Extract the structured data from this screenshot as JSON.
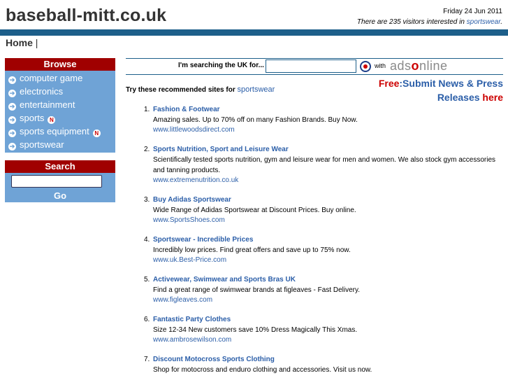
{
  "header": {
    "site_title": "baseball-mitt.co.uk",
    "date": "Friday 24 Jun 2011",
    "visitors_prefix": "There are 235 visitors interested in ",
    "visitors_link": "sportswear",
    "visitors_suffix": "."
  },
  "nav": {
    "home": "Home",
    "sep": "|"
  },
  "sidebar": {
    "browse_title": "Browse",
    "items": [
      {
        "label": "computer game",
        "new": false
      },
      {
        "label": "electronics",
        "new": false
      },
      {
        "label": "entertainment",
        "new": false
      },
      {
        "label": "sports",
        "new": true
      },
      {
        "label": "sports equipment",
        "new": true
      },
      {
        "label": "sportswear",
        "new": false
      }
    ],
    "new_badge": "N",
    "search_title": "Search",
    "go_label": "Go"
  },
  "uk_search": {
    "label": "I'm searching the UK for...",
    "with": "with",
    "logo_left": "ads",
    "logo_o": "o",
    "logo_right": "nline"
  },
  "intro": {
    "text": "Try these recommended sites for ",
    "link": "sportswear"
  },
  "promo": {
    "free": "Free",
    "line1": ":Submit News & Press",
    "line2a": "Releases ",
    "line2b": "here"
  },
  "results": [
    {
      "num": "1.",
      "title": "Fashion & Footwear",
      "desc": "Amazing sales. Up to 70% off on many Fashion Brands. Buy Now.",
      "url": "www.littlewoodsdirect.com"
    },
    {
      "num": "2.",
      "title": "Sports Nutrition, Sport and Leisure Wear",
      "desc": "Scientifically tested sports nutrition, gym and leisure wear for men and women. We also stock gym accessories and tanning products.",
      "url": "www.extremenutrition.co.uk"
    },
    {
      "num": "3.",
      "title": "Buy Adidas Sportswear",
      "desc": "Wide Range of Adidas Sportswear at Discount Prices. Buy online.",
      "url": "www.SportsShoes.com"
    },
    {
      "num": "4.",
      "title": "Sportswear - Incredible Prices",
      "desc": "Incredibly low prices. Find great offers and save up to 75% now.",
      "url": "www.uk.Best-Price.com"
    },
    {
      "num": "5.",
      "title": "Activewear, Swimwear and Sports Bras UK",
      "desc": "Find a great range of swimwear brands at figleaves - Fast Delivery.",
      "url": "www.figleaves.com"
    },
    {
      "num": "6.",
      "title": "Fantastic Party Clothes",
      "desc": "Size 12-34 New customers save 10% Dress Magically This Xmas.",
      "url": "www.ambrosewilson.com"
    },
    {
      "num": "7.",
      "title": "Discount Motocross Sports Clothing",
      "desc": "Shop for motocross and enduro clothing and accessories. Visit us now.",
      "url": ""
    }
  ]
}
